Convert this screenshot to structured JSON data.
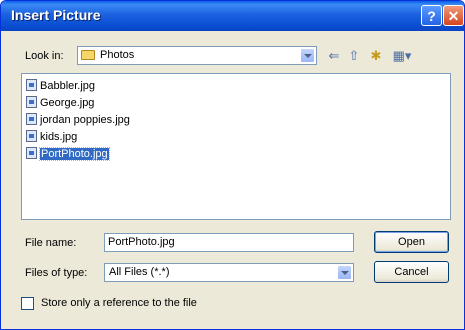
{
  "window": {
    "title": "Insert Picture",
    "help_glyph": "?",
    "close_glyph": "✕"
  },
  "look_in": {
    "label": "Look in:",
    "value": "Photos"
  },
  "toolbar": {
    "back_glyph": "⇐",
    "up_glyph": "⇧",
    "new_folder_glyph": "✱",
    "views_glyph": "▦▾"
  },
  "files": [
    "Babbler.jpg",
    "George.jpg",
    "jordan poppies.jpg",
    "kids.jpg",
    "PortPhoto.jpg"
  ],
  "selected_file": "PortPhoto.jpg",
  "file_name": {
    "label": "File name:",
    "value": "PortPhoto.jpg"
  },
  "file_type": {
    "label": "Files of type:",
    "value": "All Files (*.*)"
  },
  "buttons": {
    "open": "Open",
    "cancel": "Cancel"
  },
  "checkbox": {
    "label": "Store only a reference to the file",
    "checked": false
  }
}
